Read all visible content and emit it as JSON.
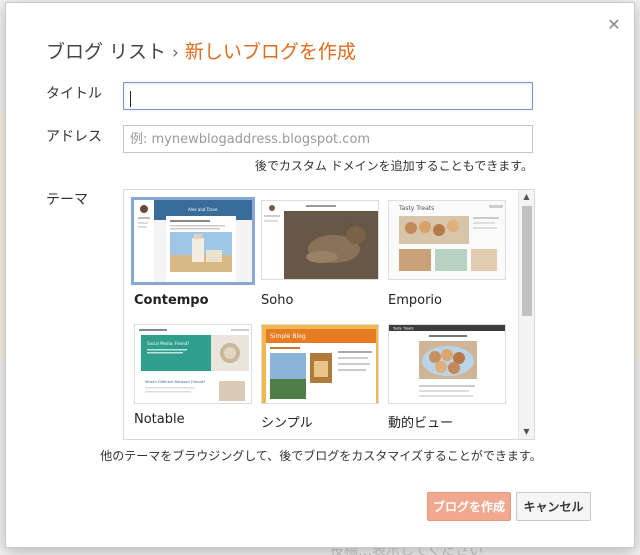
{
  "dialog": {
    "close_icon": "close-icon",
    "breadcrumb": {
      "parent": "ブログ リスト",
      "separator": "›",
      "current": "新しいブログを作成"
    },
    "title_field": {
      "label": "タイトル",
      "value": ""
    },
    "address_field": {
      "label": "アドレス",
      "placeholder": "例: mynewblogaddress.blogspot.com",
      "hint": "後でカスタム ドメインを追加することもできます。"
    },
    "theme_section": {
      "label": "テーマ",
      "themes": [
        {
          "name": "Contempo",
          "selected": true
        },
        {
          "name": "Soho",
          "selected": false
        },
        {
          "name": "Emporio",
          "selected": false
        },
        {
          "name": "Notable",
          "selected": false
        },
        {
          "name": "シンプル",
          "selected": false
        },
        {
          "name": "動的ビュー",
          "selected": false
        }
      ],
      "previews": {
        "contempo_title": "Alex and Trave",
        "emporio_title": "Tasty Treats",
        "notable_post": "Social Media: Friend?",
        "notable_post2": "What's Different Between Friends?",
        "simple_title": "Simple Blog",
        "dynamic_title": "Tasty Treats"
      }
    },
    "browse_note": "他のテーマをブラウジングして、後でブログをカスタマイズすることができます。",
    "buttons": {
      "create": "ブログを作成",
      "cancel": "キャンセル"
    }
  },
  "background": {
    "bottom_text": "投稿…表示してください"
  },
  "colors": {
    "accent": "#dd6d1d",
    "create_button": "#f0a98e",
    "focus_border": "#6f9ad3",
    "selected_border": "#8aa8d6"
  }
}
